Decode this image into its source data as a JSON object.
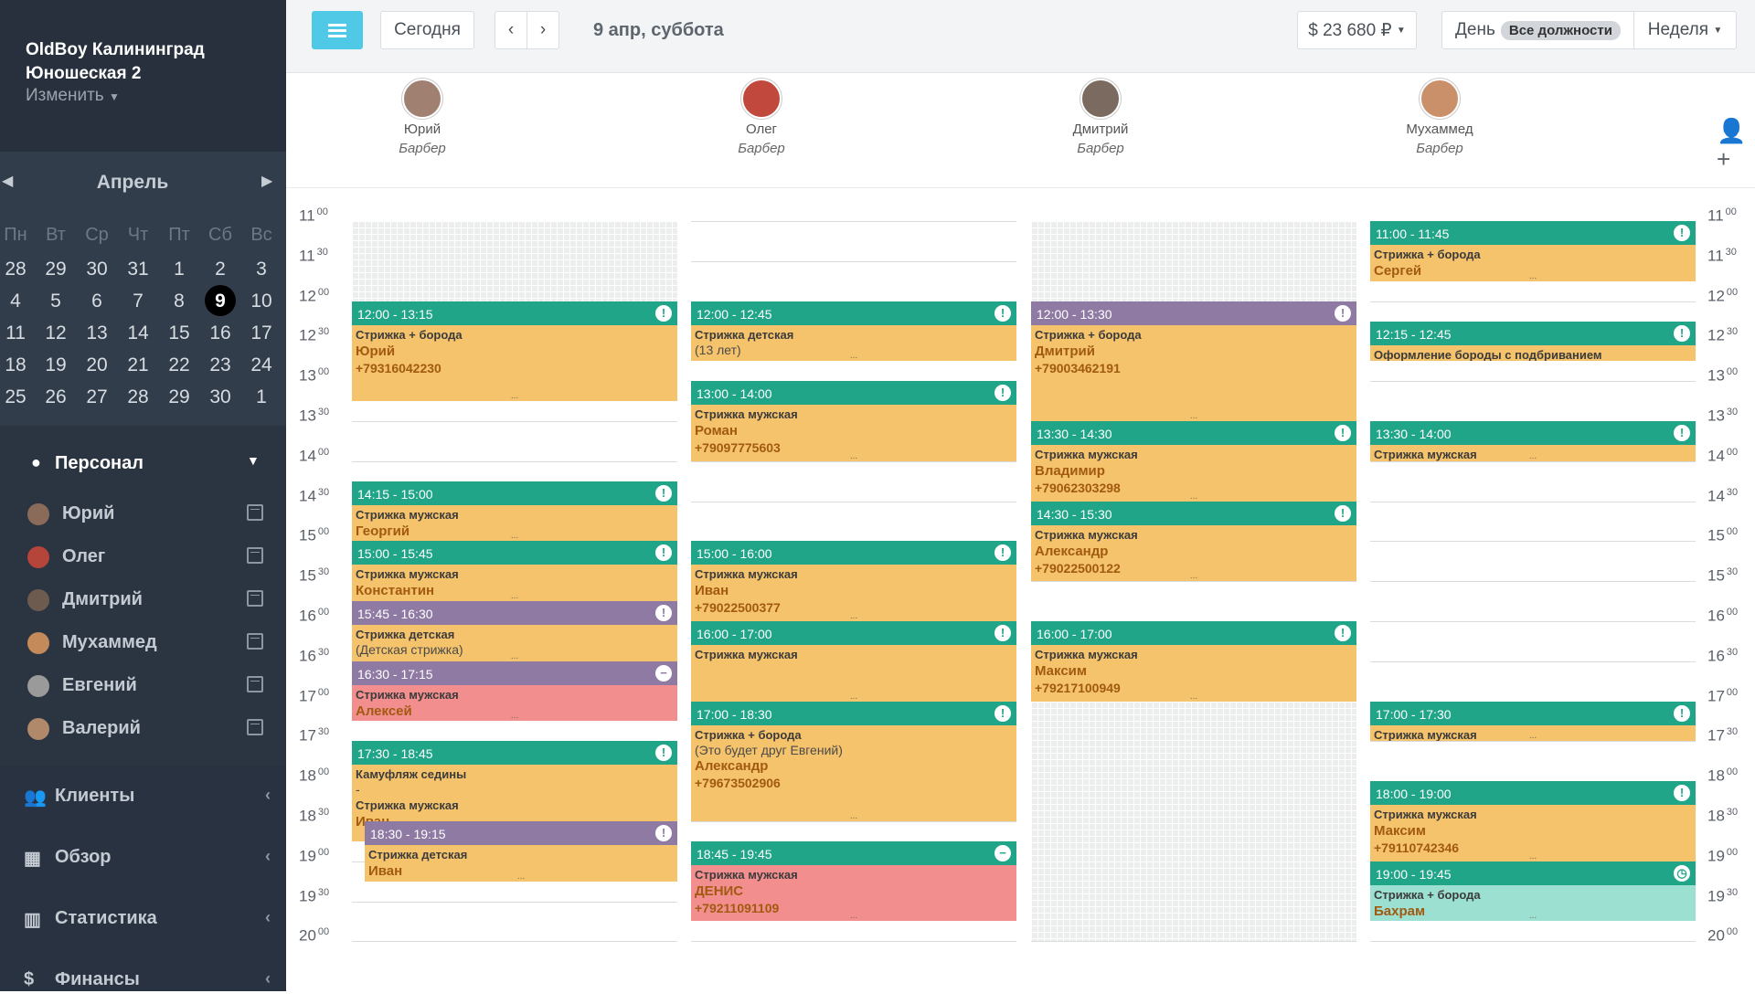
{
  "sidebar": {
    "company": "OldBoy Калининград\nЮношеская 2",
    "change": "Изменить",
    "calendar": {
      "month": "Апрель",
      "weekdays": [
        "Пн",
        "Вт",
        "Ср",
        "Чт",
        "Пт",
        "Сб",
        "Вс"
      ],
      "weeks": [
        [
          "28",
          "29",
          "30",
          "31",
          "1",
          "2",
          "3"
        ],
        [
          "4",
          "5",
          "6",
          "7",
          "8",
          "9",
          "10"
        ],
        [
          "11",
          "12",
          "13",
          "14",
          "15",
          "16",
          "17"
        ],
        [
          "18",
          "19",
          "20",
          "21",
          "22",
          "23",
          "24"
        ],
        [
          "25",
          "26",
          "27",
          "28",
          "29",
          "30",
          "1"
        ]
      ],
      "selected": "9"
    },
    "staff_title": "Персонал",
    "staff": [
      "Юрий",
      "Олег",
      "Дмитрий",
      "Мухаммед",
      "Евгений",
      "Валерий"
    ],
    "nav": [
      "Клиенты",
      "Обзор",
      "Статистика",
      "Финансы"
    ]
  },
  "topbar": {
    "today": "Сегодня",
    "date": "9 апр, суббота",
    "revenue": "$ 23 680 ₽",
    "day": "День",
    "positions": "Все должности",
    "week": "Неделя"
  },
  "employees": [
    {
      "name": "Юрий",
      "role": "Барбер"
    },
    {
      "name": "Олег",
      "role": "Барбер"
    },
    {
      "name": "Дмитрий",
      "role": "Барбер"
    },
    {
      "name": "Мухаммед",
      "role": "Барбер"
    }
  ],
  "time_labels": [
    [
      "11",
      "00"
    ],
    [
      "11",
      "30"
    ],
    [
      "12",
      "00"
    ],
    [
      "12",
      "30"
    ],
    [
      "13",
      "00"
    ],
    [
      "13",
      "30"
    ],
    [
      "14",
      "00"
    ],
    [
      "14",
      "30"
    ],
    [
      "15",
      "00"
    ],
    [
      "15",
      "30"
    ],
    [
      "16",
      "00"
    ],
    [
      "16",
      "30"
    ],
    [
      "17",
      "00"
    ],
    [
      "17",
      "30"
    ],
    [
      "18",
      "00"
    ],
    [
      "18",
      "30"
    ],
    [
      "19",
      "00"
    ],
    [
      "19",
      "30"
    ],
    [
      "20",
      "00"
    ]
  ],
  "events": [
    {
      "col": 0,
      "time": "12:00 - 13:15",
      "service": "Стрижка + борода",
      "client": "Юрий",
      "phone": "+79316042230",
      "header": "green",
      "body": "orange",
      "icon": "!"
    },
    {
      "col": 0,
      "time": "14:15 - 15:00",
      "service": "Стрижка мужская",
      "client": "Георгий",
      "header": "green",
      "body": "orange",
      "icon": "!"
    },
    {
      "col": 0,
      "time": "15:00 - 15:45",
      "service": "Стрижка мужская",
      "client": "Константин",
      "header": "green",
      "body": "orange",
      "icon": "!"
    },
    {
      "col": 0,
      "time": "15:45 - 16:30",
      "service": "Стрижка детская",
      "note": "(Детская стрижка)",
      "header": "purple",
      "body": "orange",
      "icon": "!"
    },
    {
      "col": 0,
      "time": "16:30 - 17:15",
      "service": "Стрижка мужская",
      "client": "Алексей",
      "header": "purple",
      "body": "red",
      "icon": "−"
    },
    {
      "col": 0,
      "time": "17:30 - 18:45",
      "service": "Камуфляж седины",
      "extra": "-",
      "service2": "Стрижка мужская",
      "client": "Иван",
      "header": "green",
      "body": "orange",
      "icon": "!"
    },
    {
      "col": 0,
      "time": "18:30 - 19:15",
      "service": "Стрижка детская",
      "client": "Иван",
      "header": "purple",
      "body": "orange",
      "icon": "!",
      "inset": true
    },
    {
      "col": 1,
      "time": "12:00 - 12:45",
      "service": "Стрижка детская",
      "note": "(13 лет)",
      "header": "green",
      "body": "orange",
      "icon": "!"
    },
    {
      "col": 1,
      "time": "13:00 - 14:00",
      "service": "Стрижка мужская",
      "client": "Роман",
      "phone": "+79097775603",
      "header": "green",
      "body": "orange",
      "icon": "!"
    },
    {
      "col": 1,
      "time": "15:00 - 16:00",
      "service": "Стрижка мужская",
      "client": "Иван",
      "phone": "+79022500377",
      "header": "green",
      "body": "orange",
      "icon": "!"
    },
    {
      "col": 1,
      "time": "16:00 - 17:00",
      "service": "Стрижка мужская",
      "header": "green",
      "body": "orange",
      "icon": "!"
    },
    {
      "col": 1,
      "time": "17:00 - 18:30",
      "service": "Стрижка + борода",
      "note": "(Это будет друг Евгений)",
      "client": "Александр",
      "phone": "+79673502906",
      "header": "green",
      "body": "orange",
      "icon": "!"
    },
    {
      "col": 1,
      "time": "18:45 - 19:45",
      "service": "Стрижка мужская",
      "client": "ДЕНИС",
      "phone": "+79211091109",
      "header": "green",
      "body": "red",
      "icon": "−"
    },
    {
      "col": 2,
      "time": "12:00 - 13:30",
      "service": "Стрижка + борода",
      "client": "Дмитрий",
      "phone": "+79003462191",
      "header": "purple",
      "body": "orange",
      "icon": "!"
    },
    {
      "col": 2,
      "time": "13:30 - 14:30",
      "service": "Стрижка мужская",
      "client": "Владимир",
      "phone": "+79062303298",
      "header": "green",
      "body": "orange",
      "icon": "!"
    },
    {
      "col": 2,
      "time": "14:30 - 15:30",
      "service": "Стрижка мужская",
      "client": "Александр",
      "phone": "+79022500122",
      "header": "green",
      "body": "orange",
      "icon": "!"
    },
    {
      "col": 2,
      "time": "16:00 - 17:00",
      "service": "Стрижка мужская",
      "client": "Максим",
      "phone": "+79217100949",
      "header": "green",
      "body": "orange",
      "icon": "!"
    },
    {
      "col": 3,
      "time": "11:00 - 11:45",
      "service": "Стрижка + борода",
      "client": "Сергей",
      "header": "green",
      "body": "orange",
      "icon": "!"
    },
    {
      "col": 3,
      "time": "12:15 - 12:45",
      "service": "Оформление бороды с подбриванием",
      "header": "green",
      "body": "orange",
      "icon": "!"
    },
    {
      "col": 3,
      "time": "13:30 - 14:00",
      "service": "Стрижка мужская",
      "header": "green",
      "body": "orange",
      "icon": "!"
    },
    {
      "col": 3,
      "time": "17:00 - 17:30",
      "service": "Стрижка мужская",
      "header": "green",
      "body": "orange",
      "icon": "!"
    },
    {
      "col": 3,
      "time": "18:00 - 19:00",
      "service": "Стрижка мужская",
      "client": "Максим",
      "phone": "+79110742346",
      "header": "green",
      "body": "orange",
      "icon": "!"
    },
    {
      "col": 3,
      "time": "19:00 - 19:45",
      "service": "Стрижка + борода",
      "client": "Бахрам",
      "header": "green",
      "body": "teal",
      "icon": "◷"
    }
  ]
}
